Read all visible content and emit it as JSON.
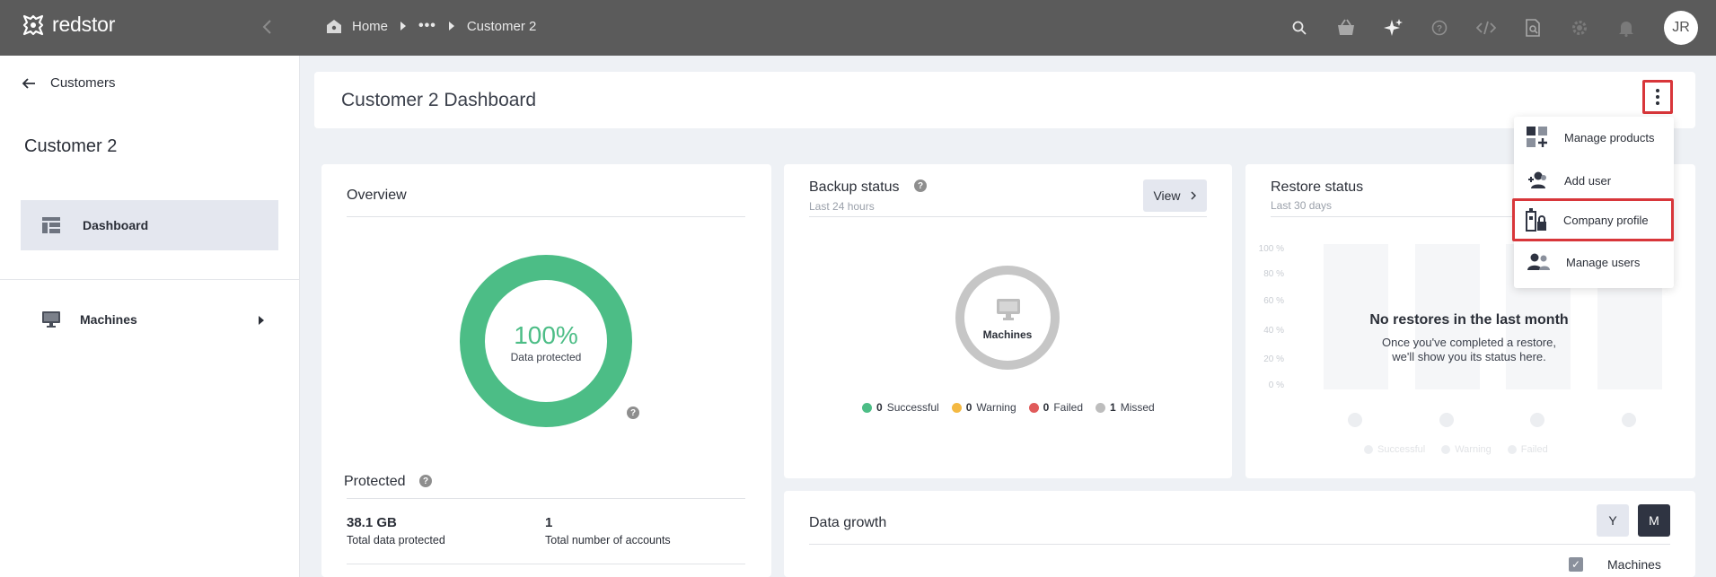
{
  "brand": {
    "name": "redstor"
  },
  "breadcrumb": {
    "home": "Home",
    "ellipsis": "•••",
    "current": "Customer 2"
  },
  "topbar": {
    "icons": [
      "search-icon",
      "basket-icon",
      "sparkle-icon",
      "help-icon",
      "code-icon",
      "document-search-icon",
      "gear-icon",
      "bell-icon"
    ],
    "avatar_initials": "JR"
  },
  "sidebar": {
    "back_label": "Customers",
    "customer_name": "Customer 2",
    "items": [
      {
        "label": "Dashboard",
        "icon": "dashboard-icon",
        "active": true
      },
      {
        "label": "Machines",
        "icon": "monitor-icon",
        "active": false
      }
    ]
  },
  "header": {
    "title": "Customer 2 Dashboard"
  },
  "menu": {
    "items": [
      {
        "label": "Manage products",
        "icon": "grid-plus-icon"
      },
      {
        "label": "Add user",
        "icon": "add-user-icon"
      },
      {
        "label": "Company profile",
        "icon": "building-lock-icon",
        "highlighted": true
      },
      {
        "label": "Manage users",
        "icon": "users-icon"
      }
    ]
  },
  "overview": {
    "title": "Overview",
    "donut_value": "100%",
    "donut_label": "Data protected",
    "help": "?",
    "protected_title": "Protected",
    "stats": [
      {
        "value": "38.1 GB",
        "label": "Total data protected"
      },
      {
        "value": "1",
        "label": "Total number of accounts"
      }
    ]
  },
  "backup": {
    "title": "Backup status",
    "subtitle": "Last 24 hours",
    "view_label": "View",
    "help": "?",
    "ring_label": "Machines",
    "legend": [
      {
        "count": "0",
        "label": "Successful",
        "color": "#4cbd86"
      },
      {
        "count": "0",
        "label": "Warning",
        "color": "#f4b942"
      },
      {
        "count": "0",
        "label": "Failed",
        "color": "#e05a5a"
      },
      {
        "count": "1",
        "label": "Missed",
        "color": "#bdbdbd"
      }
    ]
  },
  "restore": {
    "title": "Restore status",
    "subtitle": "Last 30 days",
    "y_ticks": [
      "100 %",
      "80 %",
      "60 %",
      "40 %",
      "20 %",
      "0 %"
    ],
    "empty_title": "No restores in the last month",
    "empty_line1": "Once you've completed a restore,",
    "empty_line2": "we'll show you its status here.",
    "legend": [
      "Successful",
      "Warning",
      "Failed"
    ]
  },
  "data_growth": {
    "title": "Data growth",
    "toggle_y": "Y",
    "toggle_m": "M",
    "series_label": "Machines"
  },
  "colors": {
    "accent_green": "#4cbd86",
    "highlight_red": "#d8363a",
    "topbar": "#5b5b5b"
  }
}
